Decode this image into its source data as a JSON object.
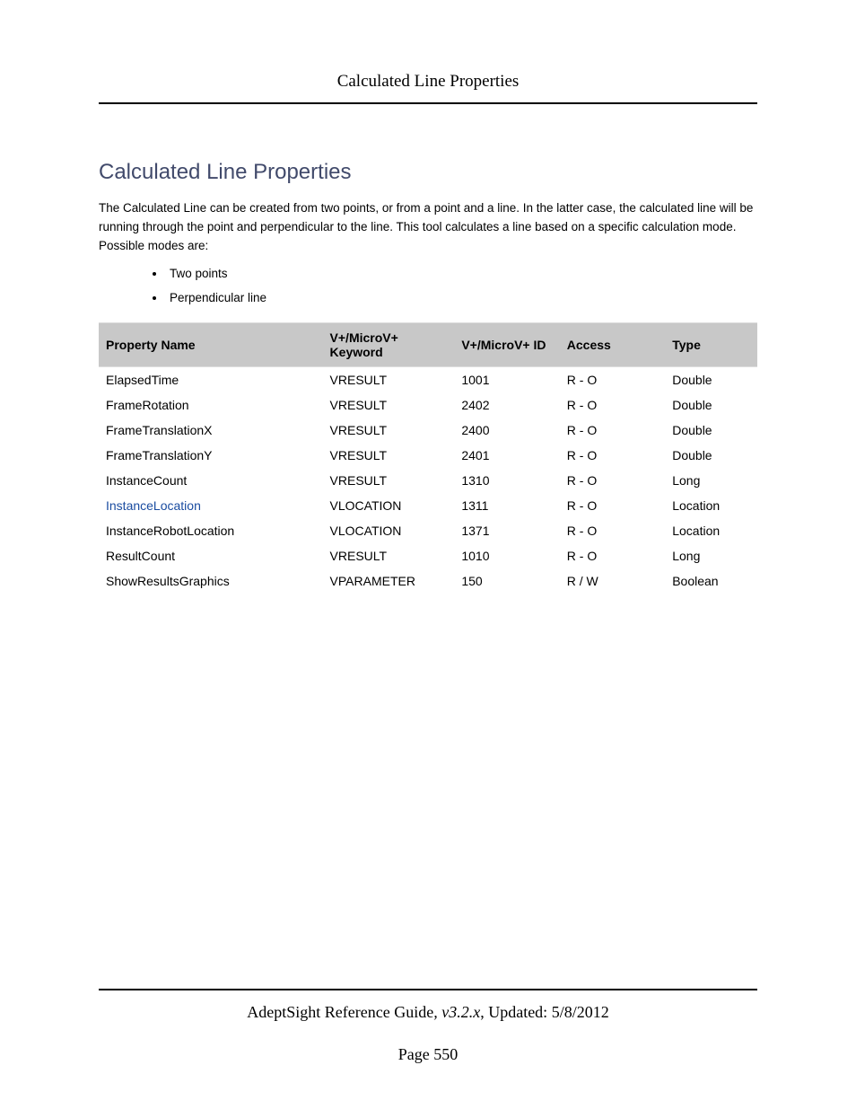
{
  "header": {
    "title": "Calculated Line Properties"
  },
  "section": {
    "heading": "Calculated Line Properties",
    "intro": "The Calculated Line can be created from two points, or from a point and a line. In the latter case, the calculated line will be running through the point and perpendicular to the line. This tool calculates a line based on a specific calculation mode. Possible modes are:",
    "modes": [
      "Two points",
      "Perpendicular line"
    ]
  },
  "table": {
    "headers": {
      "name": "Property Name",
      "keyword": "V+/MicroV+ Keyword",
      "id": "V+/MicroV+ ID",
      "access": "Access",
      "type": "Type"
    },
    "rows": [
      {
        "name": "ElapsedTime",
        "keyword": "VRESULT",
        "id": "1001",
        "access": "R - O",
        "type": "Double",
        "link": false
      },
      {
        "name": "FrameRotation",
        "keyword": "VRESULT",
        "id": "2402",
        "access": "R - O",
        "type": "Double",
        "link": false
      },
      {
        "name": "FrameTranslationX",
        "keyword": "VRESULT",
        "id": "2400",
        "access": "R - O",
        "type": "Double",
        "link": false
      },
      {
        "name": "FrameTranslationY",
        "keyword": "VRESULT",
        "id": "2401",
        "access": "R - O",
        "type": "Double",
        "link": false
      },
      {
        "name": "InstanceCount",
        "keyword": "VRESULT",
        "id": "1310",
        "access": "R - O",
        "type": "Long",
        "link": false
      },
      {
        "name": "InstanceLocation",
        "keyword": "VLOCATION",
        "id": "1311",
        "access": "R - O",
        "type": "Location",
        "link": true
      },
      {
        "name": "InstanceRobotLocation",
        "keyword": "VLOCATION",
        "id": "1371",
        "access": "R - O",
        "type": "Location",
        "link": false
      },
      {
        "name": "ResultCount",
        "keyword": "VRESULT",
        "id": "1010",
        "access": "R - O",
        "type": "Long",
        "link": false
      },
      {
        "name": "ShowResultsGraphics",
        "keyword": "VPARAMETER",
        "id": "150",
        "access": "R / W",
        "type": "Boolean",
        "link": false
      }
    ]
  },
  "footer": {
    "doc_title": "AdeptSight Reference Guide",
    "version": ", v3.2.x",
    "updated_label": ", Updated: ",
    "updated_date": "5/8/2012",
    "page_label": "Page ",
    "page_number": "550"
  }
}
